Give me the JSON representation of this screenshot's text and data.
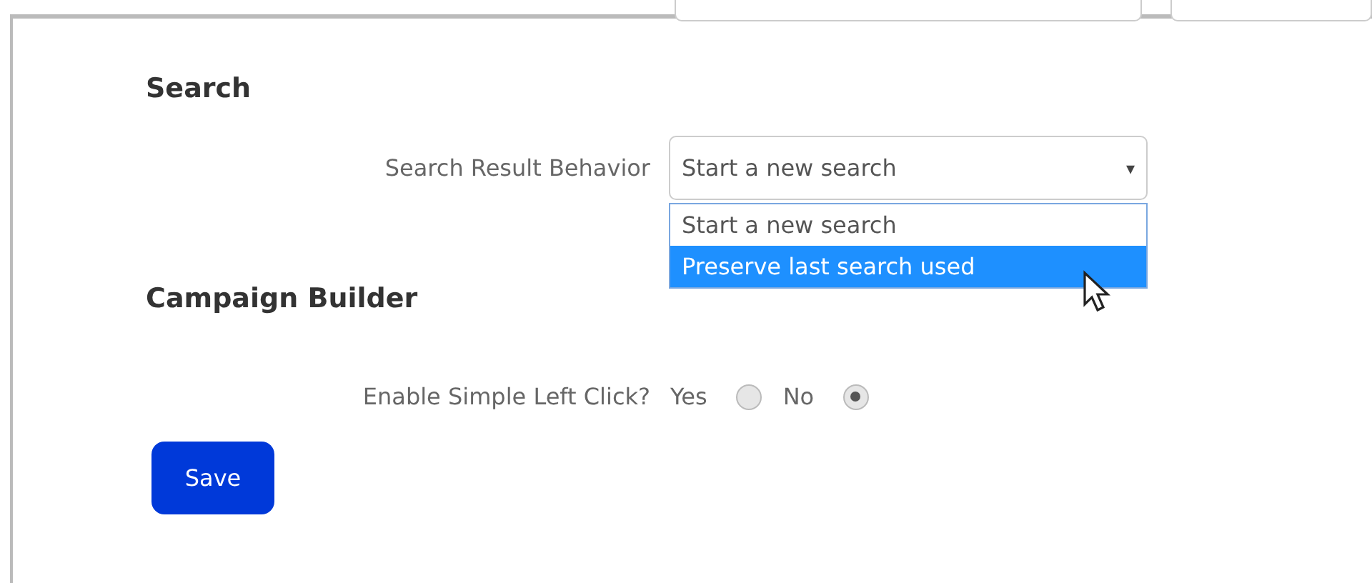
{
  "sections": [
    {
      "heading": "Search",
      "fields": [
        {
          "kind": "select",
          "label": "Search Result Behavior",
          "value": "Start a new search",
          "caret": "▾",
          "expanded": true,
          "options": [
            {
              "label": "Start a new search",
              "highlighted": false
            },
            {
              "label": "Preserve last search used",
              "highlighted": true
            }
          ]
        }
      ]
    },
    {
      "heading": "Campaign Builder",
      "fields": [
        {
          "kind": "radio",
          "label": "Enable Simple Left Click?",
          "options": [
            {
              "label": "Yes",
              "selected": false
            },
            {
              "label": "No",
              "selected": true
            }
          ]
        }
      ]
    }
  ],
  "save_button": "Save"
}
